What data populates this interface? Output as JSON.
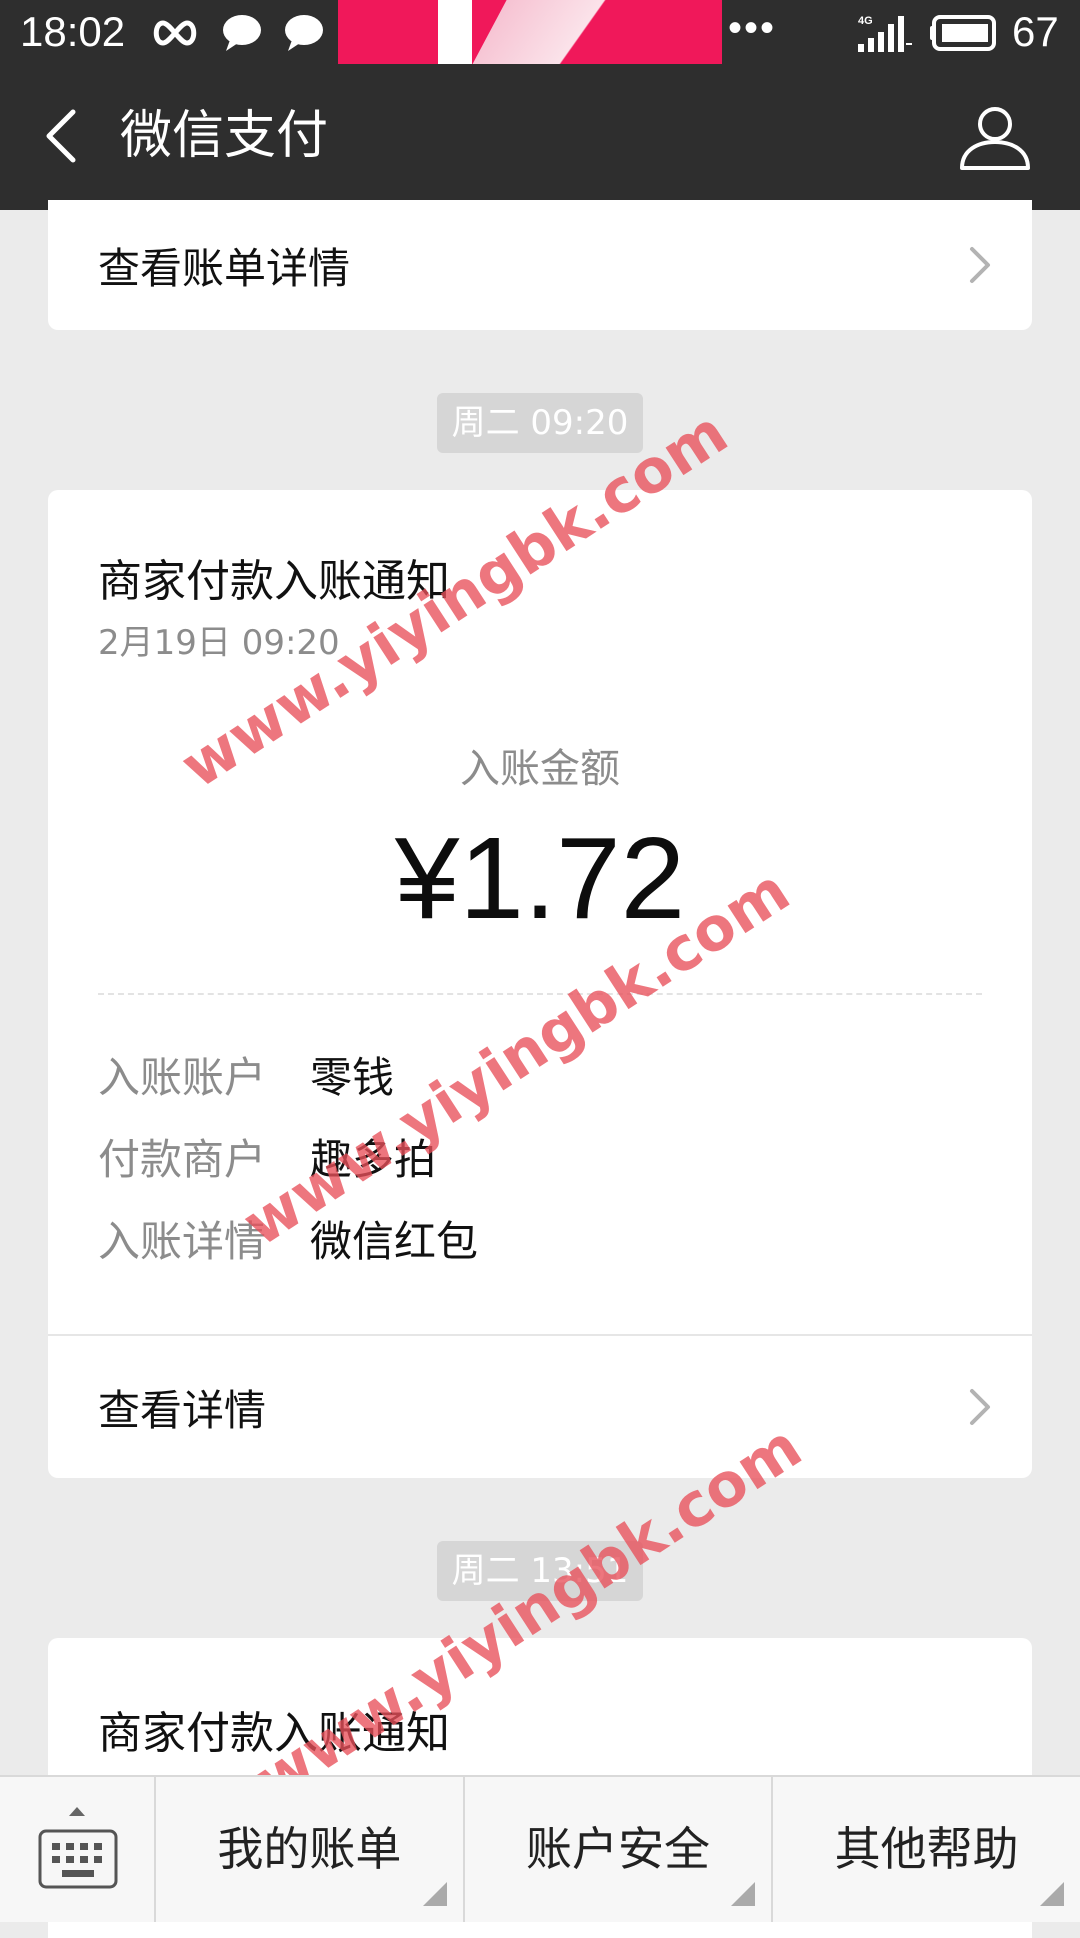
{
  "status_bar": {
    "time": "18:02",
    "dots": "•••",
    "network": "4G",
    "battery": "67"
  },
  "header": {
    "title": "微信支付"
  },
  "bill_row": {
    "label": "查看账单详情"
  },
  "messages": [
    {
      "time_badge": "周二 09:20",
      "title": "商家付款入账通知",
      "date": "2月19日  09:20",
      "amount_label": "入账金额",
      "amount": "¥1.72",
      "details": [
        {
          "key": "入账账户",
          "value": "零钱"
        },
        {
          "key": "付款商户",
          "value": "趣多拍"
        },
        {
          "key": "入账详情",
          "value": "微信红包"
        }
      ],
      "link_label": "查看详情"
    },
    {
      "time_badge": "周二 13:51",
      "title": "商家付款入账通知"
    }
  ],
  "watermark": "www.yiyingbk.com",
  "bottom_menu": [
    {
      "label": "我的账单"
    },
    {
      "label": "账户安全"
    },
    {
      "label": "其他帮助"
    }
  ],
  "colors": {
    "header_bg": "#2e2e2e",
    "page_bg": "#ebebeb",
    "watermark": "#e8505a",
    "banner": "#f0185a"
  },
  "icons": {
    "back": "back-arrow-icon",
    "profile": "person-icon",
    "chevron": "chevron-right-icon",
    "keyboard": "keyboard-icon"
  }
}
